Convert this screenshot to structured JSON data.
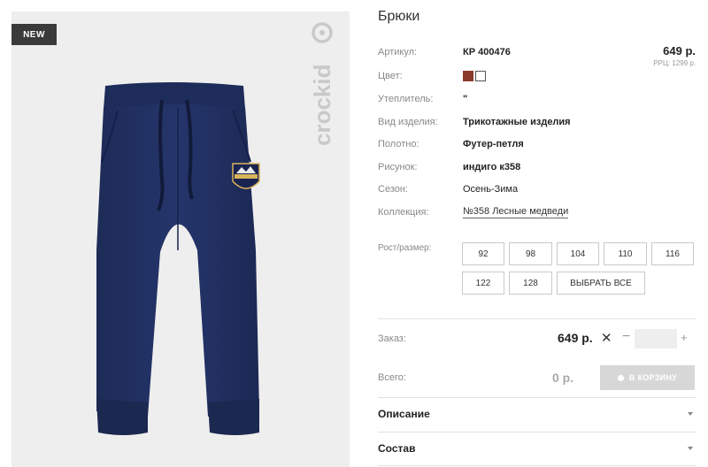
{
  "image": {
    "badge": "NEW",
    "brand": "crockid"
  },
  "product": {
    "title": "Брюки",
    "price": "649 р.",
    "rrp": "РРЦ: 1299 р."
  },
  "specs": [
    {
      "label": "Артикул:",
      "value": "КР 400476"
    },
    {
      "label": "Цвет:",
      "value": ""
    },
    {
      "label": "Утеплитель:",
      "value": "\""
    },
    {
      "label": "Вид изделия:",
      "value": "Трикотажные изделия"
    },
    {
      "label": "Полотно:",
      "value": "Футер-петля"
    },
    {
      "label": "Рисунок:",
      "value": "индиго к358"
    },
    {
      "label": "Сезон:",
      "value": "Осень-Зима"
    },
    {
      "label": "Коллекция:",
      "value": "№358 Лесные медведи"
    }
  ],
  "colors": [
    "#8b3a2c",
    "#ffffff"
  ],
  "sizes": {
    "label": "Рост/размер:",
    "options": [
      "92",
      "98",
      "104",
      "110",
      "116",
      "122",
      "128"
    ],
    "select_all": "ВЫБРАТЬ ВСЕ"
  },
  "order": {
    "label": "Заказ:",
    "price": "649 р.",
    "times": "✕",
    "minus": "−",
    "plus": "+",
    "quantity": ""
  },
  "total": {
    "label": "Всего:",
    "price": "0 р.",
    "cart_button": "В КОРЗИНУ"
  },
  "accordions": [
    "Описание",
    "Состав"
  ]
}
